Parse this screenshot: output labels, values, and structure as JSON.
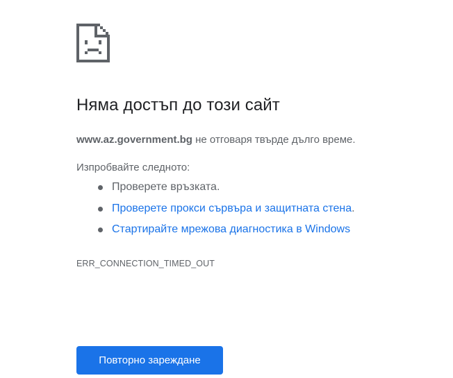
{
  "error_page": {
    "icon": "sad-page-icon",
    "title": "Няма достъп до този сайт",
    "host": "www.az.government.bg",
    "summary_suffix": " не отговаря твърде дълго време.",
    "suggestions_heading": "Изпробвайте следното:",
    "suggestions": [
      {
        "text": "Проверете връзката.",
        "link": "",
        "suffix": ""
      },
      {
        "text": "",
        "link": "Проверете прокси сървъра и защитната стена",
        "suffix": "."
      },
      {
        "text": "",
        "link": "Стартирайте мрежова диагностика в Windows",
        "suffix": ""
      }
    ],
    "error_code": "ERR_CONNECTION_TIMED_OUT",
    "reload_label": "Повторно зареждане"
  },
  "colors": {
    "accent": "#1a73e8",
    "text_primary": "#202124",
    "text_secondary": "#5f6368",
    "background": "#ffffff"
  }
}
